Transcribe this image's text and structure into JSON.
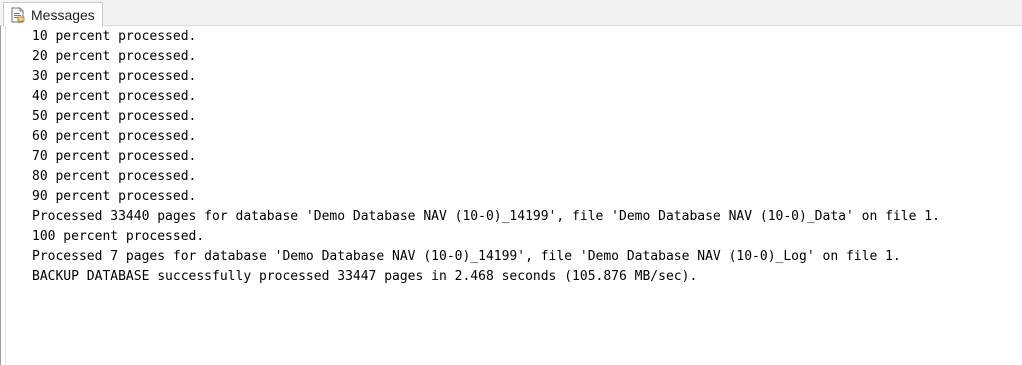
{
  "tab": {
    "label": "Messages",
    "icon": "messages-page-icon"
  },
  "messages": [
    "10 percent processed.",
    "20 percent processed.",
    "30 percent processed.",
    "40 percent processed.",
    "50 percent processed.",
    "60 percent processed.",
    "70 percent processed.",
    "80 percent processed.",
    "90 percent processed.",
    "Processed 33440 pages for database 'Demo Database NAV (10-0)_14199', file 'Demo Database NAV (10-0)_Data' on file 1.",
    "100 percent processed.",
    "Processed 7 pages for database 'Demo Database NAV (10-0)_14199', file 'Demo Database NAV (10-0)_Log' on file 1.",
    "BACKUP DATABASE successfully processed 33447 pages in 2.468 seconds (105.876 MB/sec)."
  ]
}
